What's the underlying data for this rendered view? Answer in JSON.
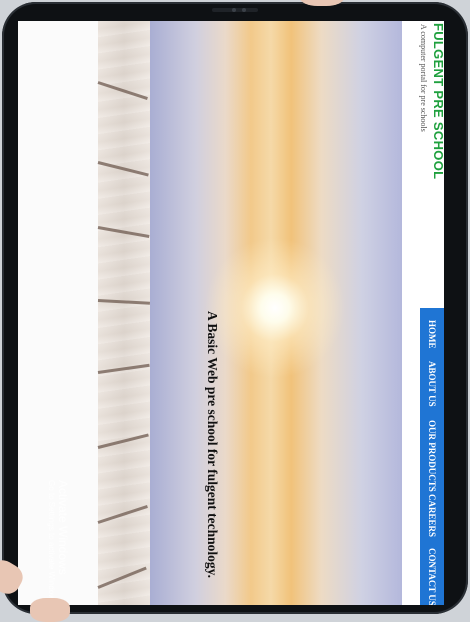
{
  "site": {
    "brand": "FULGENT PRE SCHOOL",
    "tagline": "A computer portal for pre schools",
    "hero_text": "A Basic Web pre school for fulgent technology.",
    "nav": [
      "HOME",
      "ABOUT US",
      "OUR PRODUCTS",
      "CAREERS",
      "CONTACT US"
    ]
  },
  "watermark": {
    "title": "Activate Windows",
    "subtitle": "Go to Settings to activate Windows."
  },
  "colors": {
    "brand": "#1fa03e",
    "nav_bg": "#1f75d4",
    "frame": "#0e1114"
  }
}
